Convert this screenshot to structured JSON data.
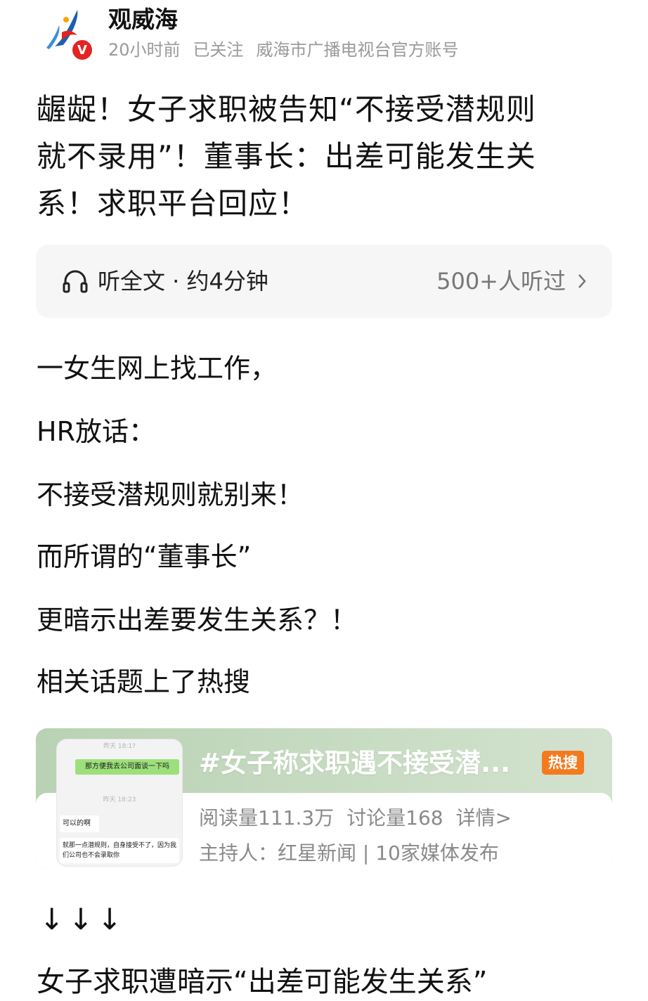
{
  "account": {
    "name": "观威海",
    "verified_badge": "V",
    "time": "20小时前",
    "follow_status": "已关注",
    "description": "威海市广播电视台官方账号",
    "logo_colors": [
      "#1b5fb0",
      "#e2231a",
      "#f2a900"
    ]
  },
  "headline": {
    "line1": "龌龊！女子求职被告知“不接受潜规则",
    "line2": "就不录用”！董事长：出差可能发生关",
    "line3": "系！求职平台回应！"
  },
  "listen": {
    "icon": "headphone-icon",
    "label": "听全文 · 约4分钟",
    "count": "500+人听过"
  },
  "body": {
    "p1": "一女生网上找工作，",
    "p2": "HR放话：",
    "p3": "不接受潜规则就别来！",
    "p4": "而所谓的“董事长”",
    "p5": "更暗示出差要发生关系？！",
    "p6": "相关话题上了热搜"
  },
  "hot_search": {
    "topic": "#女子称求职遇不接受潜...",
    "badge": "热搜",
    "badge_color": "#f47a1f",
    "reads": "阅读量111.3万",
    "discussions": "讨论量168",
    "details": "详情>",
    "host": "主持人：红星新闻 | 10家媒体发布",
    "thumbnail": {
      "time_top": "昨天 18:1?",
      "green_message": "那方便我去公司面谈一下吗",
      "time_mid": "昨天 18:23",
      "white_message_1": "可以的啊",
      "white_message_2": "就那一点潜规则，自身接受不了，因为我们公司也不会录取你"
    }
  },
  "arrows": "↓↓↓",
  "last_line": "女子求职遭暗示“出差可能发生关系”"
}
